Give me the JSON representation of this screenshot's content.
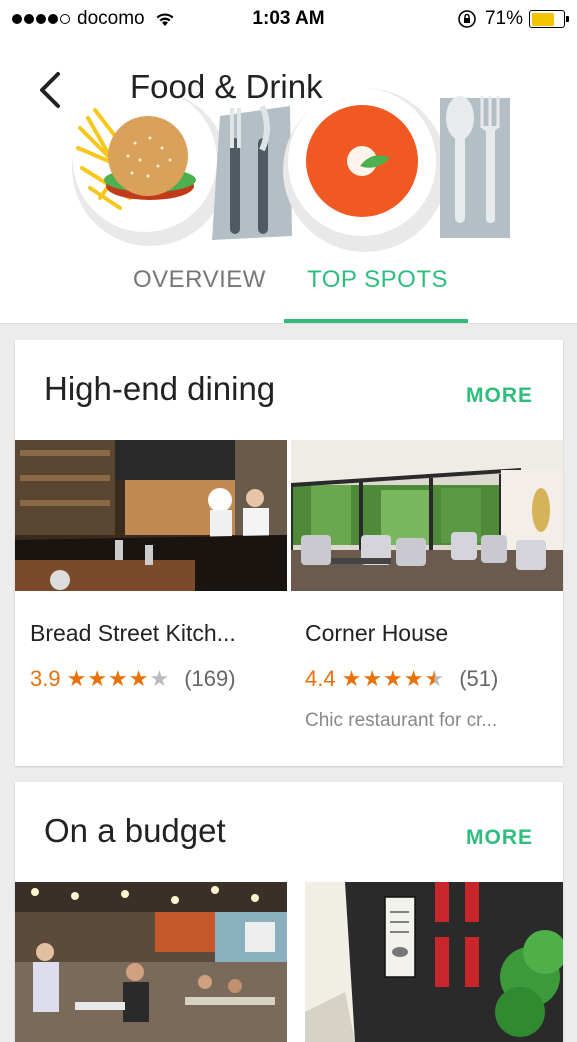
{
  "status_bar": {
    "carrier": "docomo",
    "time": "1:03 AM",
    "battery": "71%",
    "battery_level": 0.71,
    "signal_bars": 4,
    "battery_color": "#f5c400"
  },
  "header": {
    "title": "Food & Drink",
    "back_icon": "chevron-left-icon"
  },
  "tabs": [
    {
      "label": "OVERVIEW",
      "selected": false
    },
    {
      "label": "TOP SPOTS",
      "selected": true
    }
  ],
  "colors": {
    "accent": "#2ebd7d",
    "rating": "#e8710a"
  },
  "sections": [
    {
      "title": "High-end dining",
      "more_label": "MORE",
      "places": [
        {
          "name": "Bread Street Kitch...",
          "rating": "3.9",
          "stars": 3.9,
          "reviews": "(169)",
          "description": ""
        },
        {
          "name": "Corner House",
          "rating": "4.4",
          "stars": 4.4,
          "reviews": "(51)",
          "description": "Chic restaurant for cr..."
        }
      ]
    },
    {
      "title": "On a budget",
      "more_label": "MORE",
      "places": []
    }
  ]
}
